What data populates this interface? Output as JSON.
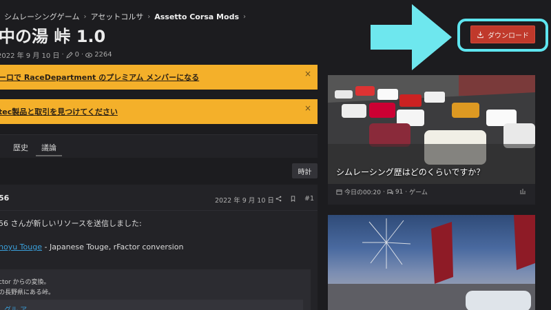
{
  "breadcrumb": {
    "items": [
      "シムレーシングゲーム",
      "アセットコルサ",
      "Assetto Corsa Mods"
    ],
    "lead_sep": "›",
    "sep": "›"
  },
  "resource": {
    "title": "中の湯 峠 1.0",
    "date": "2022 年 9 月 10 日",
    "comments": "0",
    "views": "2264"
  },
  "download": {
    "label": "ダウンロード",
    "accent": "#c0392b",
    "highlight": "#5ee5ef"
  },
  "notices": [
    {
      "text": "ーロで RaceDepartment のプレミアム メンバーになる",
      "close": "×"
    },
    {
      "text": "tec製品と取引を見つけてください",
      "close": "×"
    }
  ],
  "tabs": [
    {
      "label": "歴史"
    },
    {
      "label": "議論"
    }
  ],
  "time_button": "時計",
  "post": {
    "author": "56",
    "date": "2022 年 9 月 10 日",
    "number": "#1",
    "line1": "56 さんが新しいリソースを送信しました:",
    "link_text": "noyu Touge",
    "line2_rest": " - Japanese Touge, rFactor conversion",
    "quote_l1": "ctor からの変換。",
    "quote_l2": "の長野県にある峠。",
    "quote_l3": "グル   ア   ..."
  },
  "cards": [
    {
      "title": "シムレーシング歴はどのくらいですか？",
      "time": "今日の00:20",
      "replies": "91",
      "category": "ゲーム"
    }
  ],
  "colors": {
    "background": "#1c1c1f",
    "notice": "#f4b02a",
    "link": "#3aa0dc"
  }
}
